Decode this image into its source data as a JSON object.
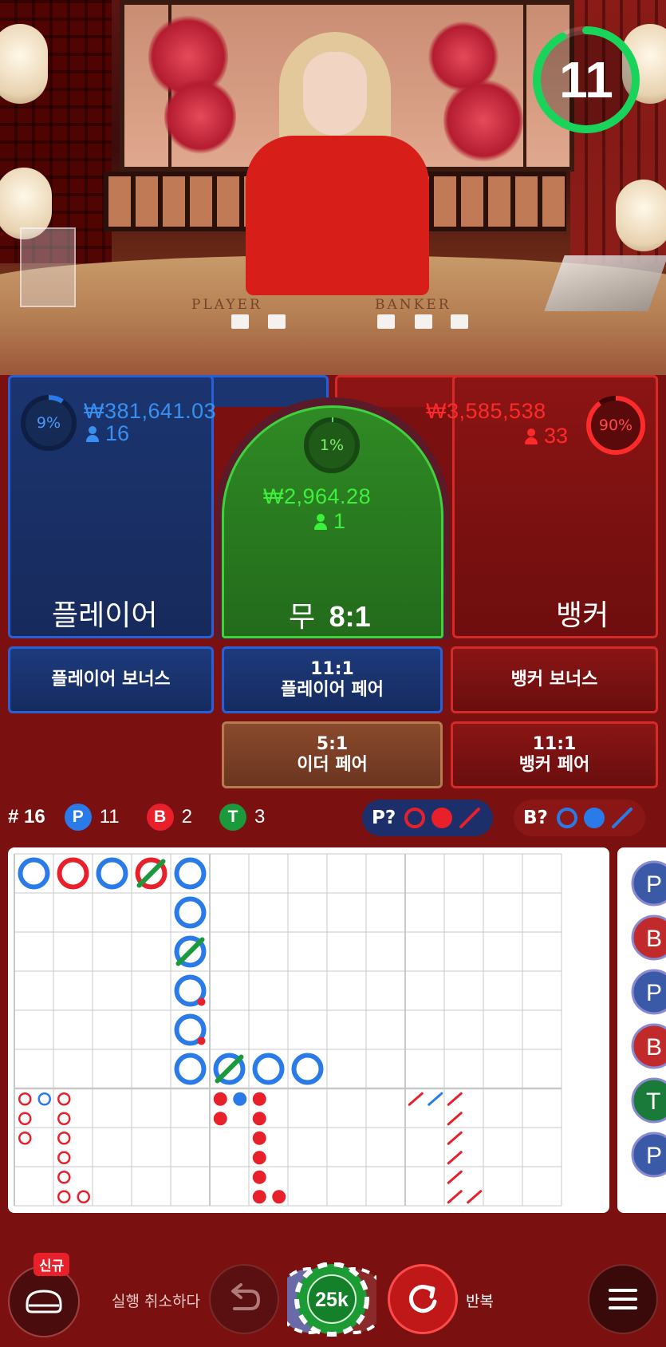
{
  "timer": {
    "seconds": "11",
    "fraction_remaining": 0.92
  },
  "table_labels": {
    "player": "PLAYER",
    "banker": "BANKER"
  },
  "player": {
    "pct": "9%",
    "pct_value": 0.09,
    "amount": "₩381,641.03",
    "count": "16",
    "label": "플레이어"
  },
  "tie": {
    "pct": "1%",
    "pct_value": 0.01,
    "amount": "₩2,964.28",
    "count": "1",
    "label": "무",
    "odds": "8:1"
  },
  "banker": {
    "pct": "90%",
    "pct_value": 0.9,
    "amount": "₩3,585,538",
    "count": "33",
    "label": "뱅커"
  },
  "side_bets": {
    "player_bonus": "플레이어 보너스",
    "player_pair_odds": "11:1",
    "player_pair": "플레이어 페어",
    "banker_bonus": "뱅커 보너스",
    "either_pair_odds": "5:1",
    "either_pair": "이더 페어",
    "banker_pair_odds": "11:1",
    "banker_pair": "뱅커 페어"
  },
  "stats": {
    "round": "# 16",
    "p_letter": "P",
    "p_count": "11",
    "b_letter": "B",
    "b_count": "2",
    "t_letter": "T",
    "t_count": "3",
    "predict_player": "P?",
    "predict_banker": "B?"
  },
  "colors": {
    "player": "#2a7be8",
    "banker": "#e8202a",
    "tie": "#1a9a3a",
    "timer": "#19d45a",
    "page_bg": "#7a1010"
  },
  "big_road": [
    {
      "col": 0,
      "row": 0,
      "side": "player",
      "tie": false
    },
    {
      "col": 1,
      "row": 0,
      "side": "banker",
      "tie": false
    },
    {
      "col": 2,
      "row": 0,
      "side": "player",
      "tie": false
    },
    {
      "col": 3,
      "row": 0,
      "side": "banker",
      "tie": true
    },
    {
      "col": 4,
      "row": 0,
      "side": "player",
      "tie": false
    },
    {
      "col": 4,
      "row": 1,
      "side": "player",
      "tie": false
    },
    {
      "col": 4,
      "row": 2,
      "side": "player",
      "tie": true
    },
    {
      "col": 4,
      "row": 3,
      "side": "player",
      "tie": false,
      "banker_pair": true
    },
    {
      "col": 4,
      "row": 4,
      "side": "player",
      "tie": false,
      "banker_pair": true
    },
    {
      "col": 4,
      "row": 5,
      "side": "player",
      "tie": false
    },
    {
      "col": 5,
      "row": 5,
      "side": "player",
      "tie": true
    },
    {
      "col": 6,
      "row": 5,
      "side": "player",
      "tie": false
    },
    {
      "col": 7,
      "row": 5,
      "side": "player",
      "tie": false
    }
  ],
  "big_eye_road": [
    {
      "col": 0,
      "row": 0,
      "color": "banker"
    },
    {
      "col": 1,
      "row": 0,
      "color": "player"
    },
    {
      "col": 2,
      "row": 0,
      "color": "banker"
    },
    {
      "col": 0,
      "row": 1,
      "color": "banker"
    },
    {
      "col": 2,
      "row": 1,
      "color": "banker"
    },
    {
      "col": 0,
      "row": 2,
      "color": "banker"
    },
    {
      "col": 2,
      "row": 2,
      "color": "banker"
    },
    {
      "col": 2,
      "row": 3,
      "color": "banker"
    },
    {
      "col": 2,
      "row": 4,
      "color": "banker"
    },
    {
      "col": 2,
      "row": 5,
      "color": "banker"
    },
    {
      "col": 3,
      "row": 5,
      "color": "banker"
    }
  ],
  "small_road": [
    {
      "col": 0,
      "row": 0,
      "color": "banker"
    },
    {
      "col": 1,
      "row": 0,
      "color": "player"
    },
    {
      "col": 2,
      "row": 0,
      "color": "banker"
    },
    {
      "col": 0,
      "row": 1,
      "color": "banker"
    },
    {
      "col": 2,
      "row": 1,
      "color": "banker"
    },
    {
      "col": 2,
      "row": 2,
      "color": "banker"
    },
    {
      "col": 2,
      "row": 3,
      "color": "banker"
    },
    {
      "col": 2,
      "row": 4,
      "color": "banker"
    },
    {
      "col": 2,
      "row": 5,
      "color": "banker"
    },
    {
      "col": 3,
      "row": 5,
      "color": "banker"
    }
  ],
  "cockroach_road": [
    {
      "col": 0,
      "row": 0,
      "color": "banker"
    },
    {
      "col": 1,
      "row": 0,
      "color": "player"
    },
    {
      "col": 2,
      "row": 0,
      "color": "banker"
    },
    {
      "col": 2,
      "row": 1,
      "color": "banker"
    },
    {
      "col": 2,
      "row": 2,
      "color": "banker"
    },
    {
      "col": 2,
      "row": 3,
      "color": "banker"
    },
    {
      "col": 2,
      "row": 4,
      "color": "banker"
    },
    {
      "col": 2,
      "row": 5,
      "color": "banker"
    },
    {
      "col": 3,
      "row": 5,
      "color": "banker"
    }
  ],
  "bead_road_partial": [
    {
      "letter": "P",
      "side": "player"
    },
    {
      "letter": "B",
      "side": "banker"
    },
    {
      "letter": "P",
      "side": "player"
    },
    {
      "letter": "B",
      "side": "banker"
    },
    {
      "letter": "T",
      "side": "tie"
    },
    {
      "letter": "P",
      "side": "player"
    }
  ],
  "bottom": {
    "new_badge": "신규",
    "undo_label": "실행 취소하다",
    "chip_value": "25k",
    "repeat_label": "반복"
  }
}
